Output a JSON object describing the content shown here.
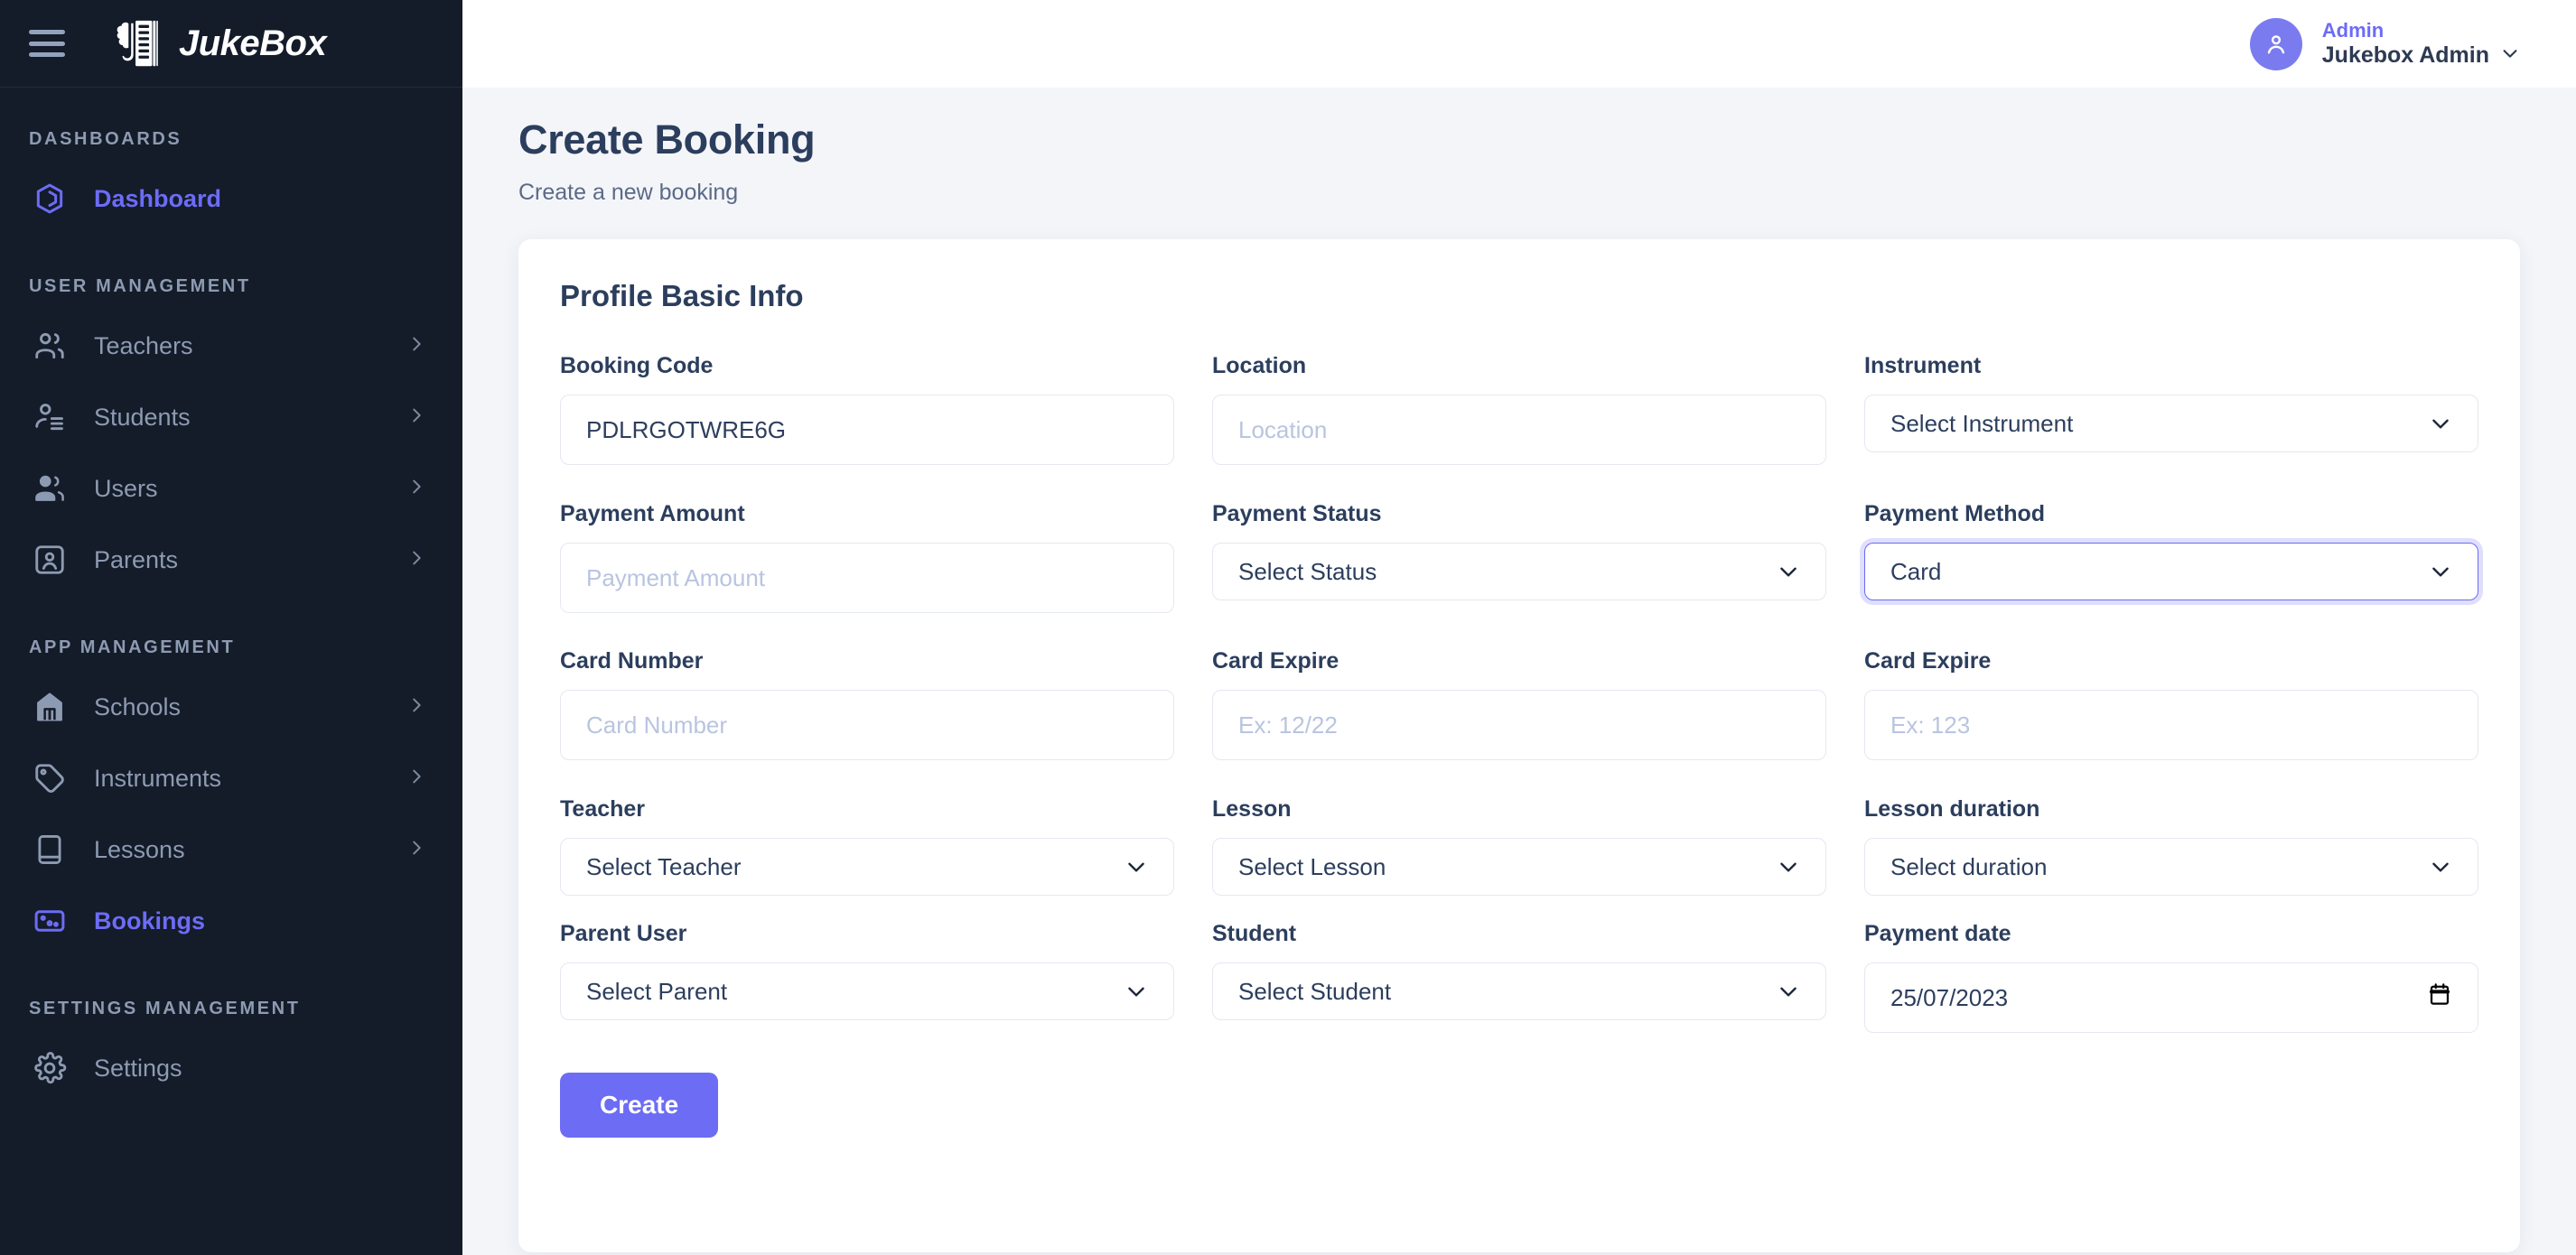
{
  "brand": {
    "name": "JukeBox",
    "logo_icon": "brain-book-icon",
    "menu_icon": "hamburger-menu-icon"
  },
  "topbar": {
    "user_role": "Admin",
    "user_name": "Jukebox Admin",
    "avatar_icon": "user-avatar-icon",
    "caret_icon": "chevron-down-icon"
  },
  "sidebar": {
    "sections": [
      {
        "title": "DASHBOARDS",
        "items": [
          {
            "label": "Dashboard",
            "icon": "dashboard-icon",
            "active": true,
            "chevron": false
          }
        ]
      },
      {
        "title": "USER MANAGEMENT",
        "items": [
          {
            "label": "Teachers",
            "icon": "teachers-icon",
            "active": false,
            "chevron": true
          },
          {
            "label": "Students",
            "icon": "students-icon",
            "active": false,
            "chevron": true
          },
          {
            "label": "Users",
            "icon": "users-icon",
            "active": false,
            "chevron": true
          },
          {
            "label": "Parents",
            "icon": "parents-icon",
            "active": false,
            "chevron": true
          }
        ]
      },
      {
        "title": "APP MANAGEMENT",
        "items": [
          {
            "label": "Schools",
            "icon": "school-icon",
            "active": false,
            "chevron": true
          },
          {
            "label": "Instruments",
            "icon": "tag-icon",
            "active": false,
            "chevron": true
          },
          {
            "label": "Lessons",
            "icon": "book-icon",
            "active": false,
            "chevron": true
          },
          {
            "label": "Bookings",
            "icon": "booking-card-icon",
            "active": true,
            "chevron": false
          }
        ]
      },
      {
        "title": "SETTINGS MANAGEMENT",
        "items": [
          {
            "label": "Settings",
            "icon": "gear-icon",
            "active": false,
            "chevron": false
          }
        ]
      }
    ]
  },
  "page": {
    "title": "Create Booking",
    "subtitle": "Create a new booking"
  },
  "form": {
    "section_title": "Profile Basic Info",
    "fields": {
      "booking_code": {
        "label": "Booking Code",
        "value": "PDLRGOTWRE6G",
        "placeholder": "Booking Code"
      },
      "location": {
        "label": "Location",
        "value": "",
        "placeholder": "Location"
      },
      "instrument": {
        "label": "Instrument",
        "value": "Select Instrument"
      },
      "payment_amount": {
        "label": "Payment Amount",
        "value": "",
        "placeholder": "Payment Amount"
      },
      "payment_status": {
        "label": "Payment Status",
        "value": "Select Status"
      },
      "payment_method": {
        "label": "Payment Method",
        "value": "Card",
        "focused": true
      },
      "card_number": {
        "label": "Card Number",
        "value": "",
        "placeholder": "Card Number"
      },
      "card_expire": {
        "label": "Card Expire",
        "value": "",
        "placeholder": "Ex: 12/22"
      },
      "card_cvc": {
        "label": "Card Expire",
        "value": "",
        "placeholder": "Ex: 123"
      },
      "teacher": {
        "label": "Teacher",
        "value": "Select Teacher"
      },
      "lesson": {
        "label": "Lesson",
        "value": "Select Lesson"
      },
      "lesson_duration": {
        "label": "Lesson duration",
        "value": "Select duration"
      },
      "parent_user": {
        "label": "Parent User",
        "value": "Select Parent"
      },
      "student": {
        "label": "Student",
        "value": "Select Student"
      },
      "payment_date": {
        "label": "Payment date",
        "value": "25/07/2023",
        "icon": "calendar-icon"
      }
    },
    "submit_label": "Create"
  },
  "colors": {
    "accent": "#6c6cf5",
    "sidebar_bg": "#141b29",
    "page_bg": "#f4f5f9",
    "heading": "#2c3e5d",
    "muted": "#8d9bb2",
    "placeholder": "#b9c4e0"
  }
}
